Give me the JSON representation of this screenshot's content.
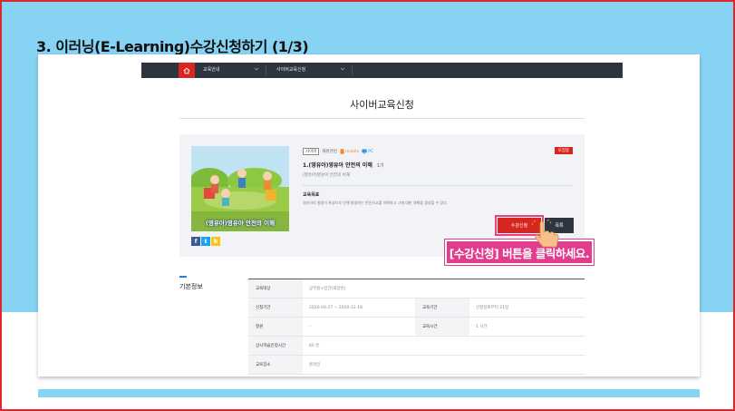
{
  "heading": "3. 이러닝(E-Learning)수강신청하기 (1/3)",
  "nav": {
    "items": [
      {
        "label": "교육안내"
      },
      {
        "label": "사이버교육신청"
      }
    ]
  },
  "page_title": "사이버교육신청",
  "course": {
    "category": "사이버",
    "type": "재원관련",
    "device_mobile": "mobile",
    "device_pc": "PC",
    "status": "모집중",
    "title": "1.(영유아)영유아 안전의 이해",
    "hours": "1기",
    "subtitle": "(영유아)영유아 안전의 이해",
    "goal_label": "교육목표",
    "goal_text": "영유아의 발달이 특성으로 인해 발생하는 안전사고를 이해하고 그에 대한 대책을 생성할 수 있다.",
    "thumbnail_caption": "(영유아)영유아 안전의 이해",
    "share": [
      "f",
      "t",
      "b"
    ],
    "apply_label": "수강신청",
    "list_label": "목록"
  },
  "section_label": "기본정보",
  "table": {
    "rows": [
      {
        "cells": [
          {
            "th": "교육대상",
            "td": "공무원+민간(희망반)"
          }
        ]
      },
      {
        "cells": [
          {
            "th": "신청기간",
            "td": "2020-04-27 ~ 2020-12-18"
          },
          {
            "th": "교육기간",
            "td": "신청일로부터 21일"
          }
        ]
      },
      {
        "cells": [
          {
            "th": "정원",
            "td": "-"
          },
          {
            "th": "교육시간",
            "td": "1 시간"
          }
        ]
      },
      {
        "cells": [
          {
            "th": "상시학습인정시간",
            "td": "60 분"
          }
        ]
      },
      {
        "cells": [
          {
            "th": "교육장소",
            "td": "온라인"
          }
        ]
      }
    ]
  },
  "callout": "[수강신청] 버튼을 클릭하세요.",
  "colors": {
    "accent_red": "#d7261f",
    "callout_pink": "#e23d8d",
    "sky": "#87d3f3",
    "nav_dark": "#2e3440"
  }
}
